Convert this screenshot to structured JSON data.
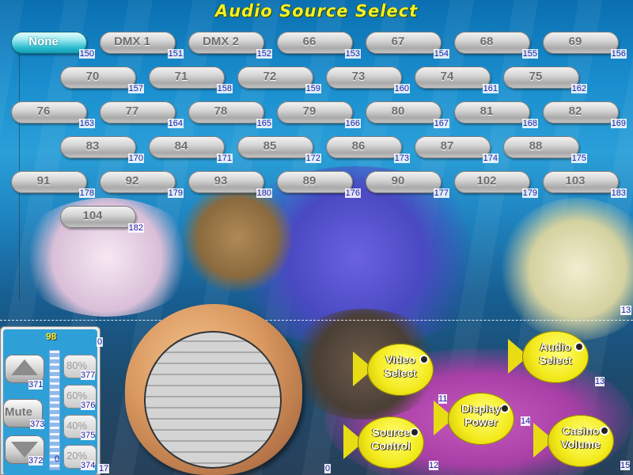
{
  "title": "Audio Source Select",
  "sources": [
    {
      "label": "None",
      "id": "150",
      "active": true
    },
    {
      "label": "DMX 1",
      "id": "151"
    },
    {
      "label": "DMX 2",
      "id": "152"
    },
    {
      "label": "66",
      "id": "153"
    },
    {
      "label": "67",
      "id": "154"
    },
    {
      "label": "68",
      "id": "155"
    },
    {
      "label": "69",
      "id": "156"
    },
    {
      "label": "70",
      "id": "157"
    },
    {
      "label": "71",
      "id": "158"
    },
    {
      "label": "72",
      "id": "159"
    },
    {
      "label": "73",
      "id": "160"
    },
    {
      "label": "74",
      "id": "161"
    },
    {
      "label": "75",
      "id": "162"
    },
    {
      "label": "76",
      "id": "163"
    },
    {
      "label": "77",
      "id": "164"
    },
    {
      "label": "78",
      "id": "165"
    },
    {
      "label": "79",
      "id": "166"
    },
    {
      "label": "80",
      "id": "167"
    },
    {
      "label": "81",
      "id": "168"
    },
    {
      "label": "82",
      "id": "169"
    },
    {
      "label": "83",
      "id": "170"
    },
    {
      "label": "84",
      "id": "171"
    },
    {
      "label": "85",
      "id": "172"
    },
    {
      "label": "86",
      "id": "173"
    },
    {
      "label": "87",
      "id": "174"
    },
    {
      "label": "88",
      "id": "175"
    },
    {
      "label": "91",
      "id": "178"
    },
    {
      "label": "92",
      "id": "179"
    },
    {
      "label": "93",
      "id": "180"
    },
    {
      "label": "89",
      "id": "176"
    },
    {
      "label": "90",
      "id": "177"
    },
    {
      "label": "102",
      "id": "179"
    },
    {
      "label": "103",
      "id": "183"
    },
    {
      "label": "104",
      "id": "182"
    }
  ],
  "volume": {
    "level": "98",
    "level_fraction": 0.98,
    "up_id": "371",
    "mute_label": "Mute",
    "mute_id": "373",
    "down_id": "372",
    "meter_id": "0",
    "panel_id": "0",
    "corner_id": "17",
    "presets": [
      {
        "label": "80%",
        "id": "377"
      },
      {
        "label": "60%",
        "id": "376"
      },
      {
        "label": "40%",
        "id": "375"
      },
      {
        "label": "20%",
        "id": "374"
      }
    ]
  },
  "display_id": "0",
  "right_marker": "13",
  "nav": [
    {
      "line1": "Video",
      "line2": "Select",
      "id": "11"
    },
    {
      "line1": "Audio",
      "line2": "Select",
      "id": "13"
    },
    {
      "line1": "Display",
      "line2": "Power",
      "id": "14"
    },
    {
      "line1": "Source",
      "line2": "Control",
      "id": "12"
    },
    {
      "line1": "Casino",
      "line2": "Volume",
      "id": "15"
    }
  ],
  "colors": {
    "title": "#f4ef2a",
    "active_button": "#26b8cc",
    "fish": "#f3ea1c",
    "id_text": "#1a1aa8"
  }
}
